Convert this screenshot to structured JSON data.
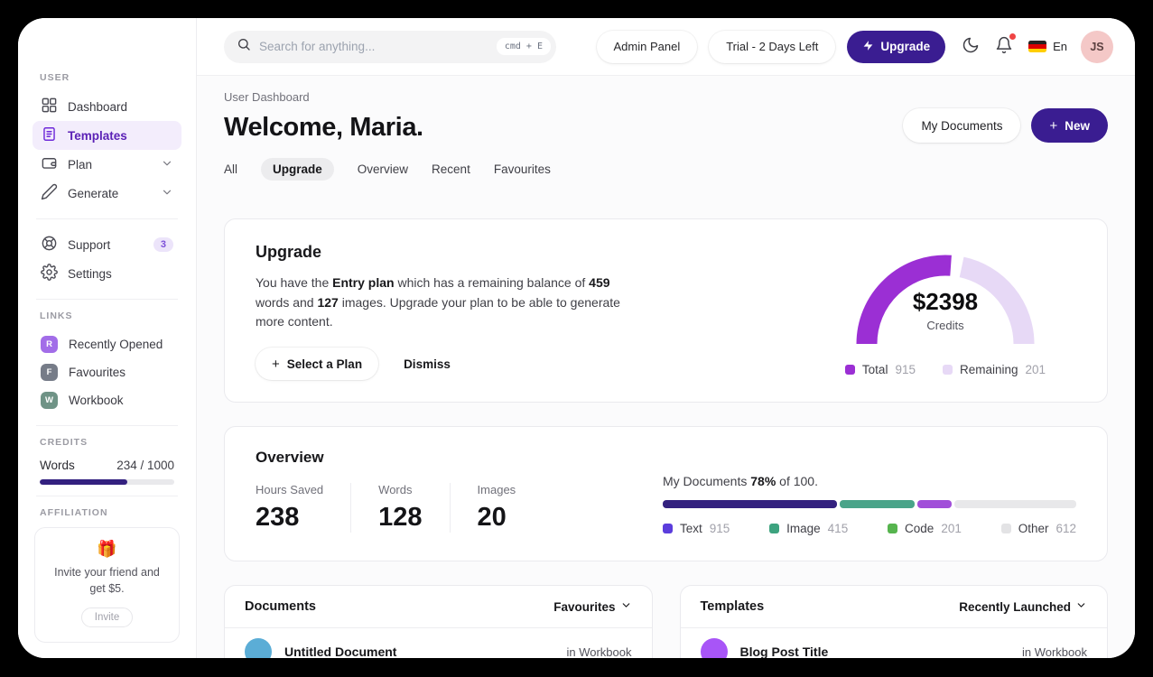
{
  "colors": {
    "accent": "#3a1d91",
    "gauge_total": "#9b2fd4",
    "gauge_remaining": "#e7d9f6",
    "credit_fill": "#33207f"
  },
  "icons": {
    "plus": "+"
  },
  "topbar": {
    "search_placeholder": "Search for anything...",
    "search_shortcut": "cmd + E",
    "admin_panel_label": "Admin Panel",
    "trial_label": "Trial - 2 Days Left",
    "upgrade_label": "Upgrade",
    "language_label": "En",
    "avatar_initials": "JS"
  },
  "sidebar": {
    "user_section_label": "USER",
    "items": [
      {
        "label": "Dashboard"
      },
      {
        "label": "Templates"
      },
      {
        "label": "Plan"
      },
      {
        "label": "Generate"
      },
      {
        "label": "Support",
        "badge": "3"
      },
      {
        "label": "Settings"
      }
    ],
    "links_section_label": "LINKS",
    "links": [
      {
        "initial": "R",
        "label": "Recently Opened",
        "color": "#a26de8"
      },
      {
        "initial": "F",
        "label": "Favourites",
        "color": "#767c88"
      },
      {
        "initial": "W",
        "label": "Workbook",
        "color": "#6f9386"
      }
    ],
    "credits_section_label": "CREDITS",
    "credits": {
      "label": "Words",
      "value": "234 / 1000",
      "fill_width": "65%"
    },
    "affiliation_section_label": "AFFILIATION",
    "affiliation": {
      "emoji": "🎁",
      "text": "Invite your friend and get $5.",
      "button_label": "Invite"
    }
  },
  "header": {
    "breadcrumb": "User Dashboard",
    "title": "Welcome, Maria.",
    "my_documents_label": "My Documents",
    "new_label": "New",
    "tabs": [
      "All",
      "Upgrade",
      "Overview",
      "Recent",
      "Favourites"
    ],
    "active_tab": "Upgrade"
  },
  "upgrade_card": {
    "title": "Upgrade",
    "body": [
      "You have the ",
      "Entry plan",
      " which has a remaining balance of ",
      "459",
      " words and ",
      "127",
      " images. Upgrade your plan to be able to generate more content."
    ],
    "select_plan_label": "Select a Plan",
    "dismiss_label": "Dismiss",
    "gauge": {
      "center_value": "$2398",
      "center_label": "Credits",
      "legend": [
        {
          "label": "Total",
          "value": "915",
          "color": "#9b2fd4"
        },
        {
          "label": "Remaining",
          "value": "201",
          "color": "#e7d9f6"
        }
      ]
    }
  },
  "overview_card": {
    "title": "Overview",
    "stats": [
      {
        "label": "Hours Saved",
        "value": "238"
      },
      {
        "label": "Words",
        "value": "128"
      },
      {
        "label": "Images",
        "value": "20"
      }
    ],
    "progress": {
      "title_parts": [
        "My Documents ",
        "78%",
        " of 100."
      ],
      "segments": [
        {
          "label": "Text",
          "value": "915",
          "bar_color": "#33217f",
          "legend_color": "#5b3ddc",
          "width": "43%"
        },
        {
          "label": "Image",
          "value": "415",
          "bar_color": "#4aa489",
          "legend_color": "#3da37f",
          "width": "18.5%"
        },
        {
          "label": "Code",
          "value": "201",
          "bar_color": "#a14fd9",
          "legend_color": "#56b44e",
          "width": "8.5%"
        },
        {
          "label": "Other",
          "value": "612",
          "bar_color": "#e8e8ea",
          "legend_color": "#e3e3e5",
          "width": "30%"
        }
      ]
    }
  },
  "documents_card": {
    "title": "Documents",
    "filter_label": "Favourites",
    "rows": [
      {
        "name": "Untitled Document",
        "location": "in Workbook",
        "avatar_color": "#5badd6"
      }
    ]
  },
  "templates_card": {
    "title": "Templates",
    "filter_label": "Recently Launched",
    "rows": [
      {
        "name": "Blog Post Title",
        "location": "in Workbook",
        "avatar_color": "#a855f7"
      }
    ]
  }
}
